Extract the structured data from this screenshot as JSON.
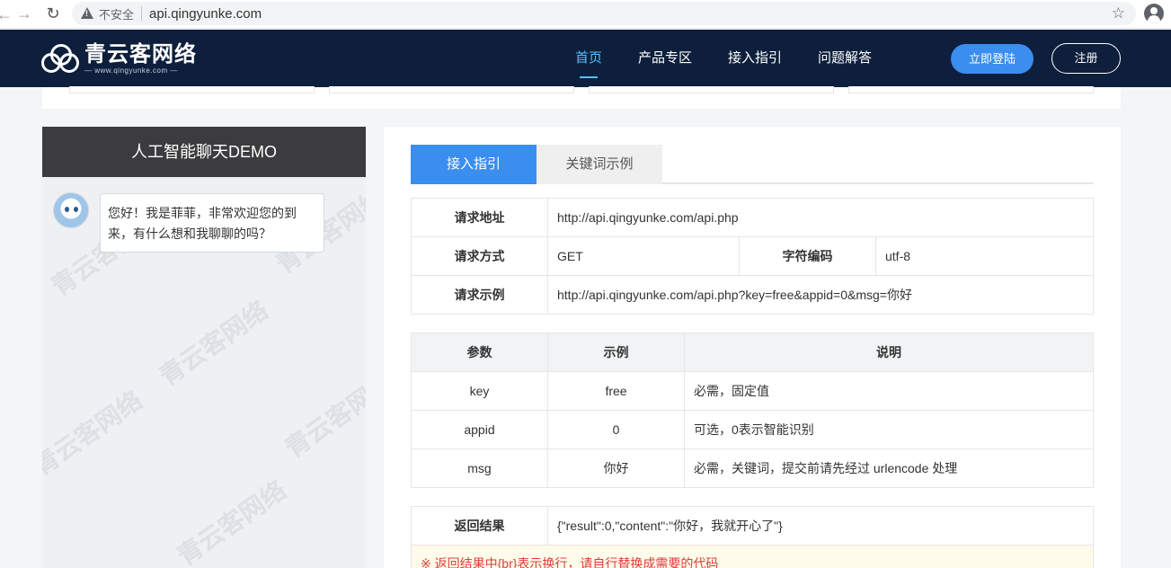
{
  "browser": {
    "security_label": "不安全",
    "url": "api.qingyunke.com"
  },
  "header": {
    "logo_name": "青云客网络",
    "logo_sub": "— www.qingyunke.com —",
    "nav": [
      "首页",
      "产品专区",
      "接入指引",
      "问题解答"
    ],
    "login_label": "立即登陆",
    "register_label": "注册"
  },
  "chat": {
    "title": "人工智能聊天DEMO",
    "message": "您好！我是菲菲，非常欢迎您的到来，有什么想和我聊聊的吗？",
    "watermark": "青云客网络"
  },
  "tabs": [
    "接入指引",
    "关键词示例"
  ],
  "request": {
    "url_label": "请求地址",
    "url_value": "http://api.qingyunke.com/api.php",
    "method_label": "请求方式",
    "method_value": "GET",
    "charset_label": "字符编码",
    "charset_value": "utf-8",
    "example_label": "请求示例",
    "example_value": "http://api.qingyunke.com/api.php?key=free&appid=0&msg=你好"
  },
  "params": {
    "headers": [
      "参数",
      "示例",
      "说明"
    ],
    "rows": [
      {
        "name": "key",
        "example": "free",
        "desc": "必需，固定值"
      },
      {
        "name": "appid",
        "example": "0",
        "desc": "可选，0表示智能识别"
      },
      {
        "name": "msg",
        "example": "你好",
        "desc": "必需，关键词，提交前请先经过 urlencode 处理"
      }
    ]
  },
  "result": {
    "label": "返回结果",
    "value": "{\"result\":0,\"content\":\"你好，我就开心了\"}",
    "notice": "※ 返回结果中{br}表示换行，请自行替换成需要的代码"
  }
}
